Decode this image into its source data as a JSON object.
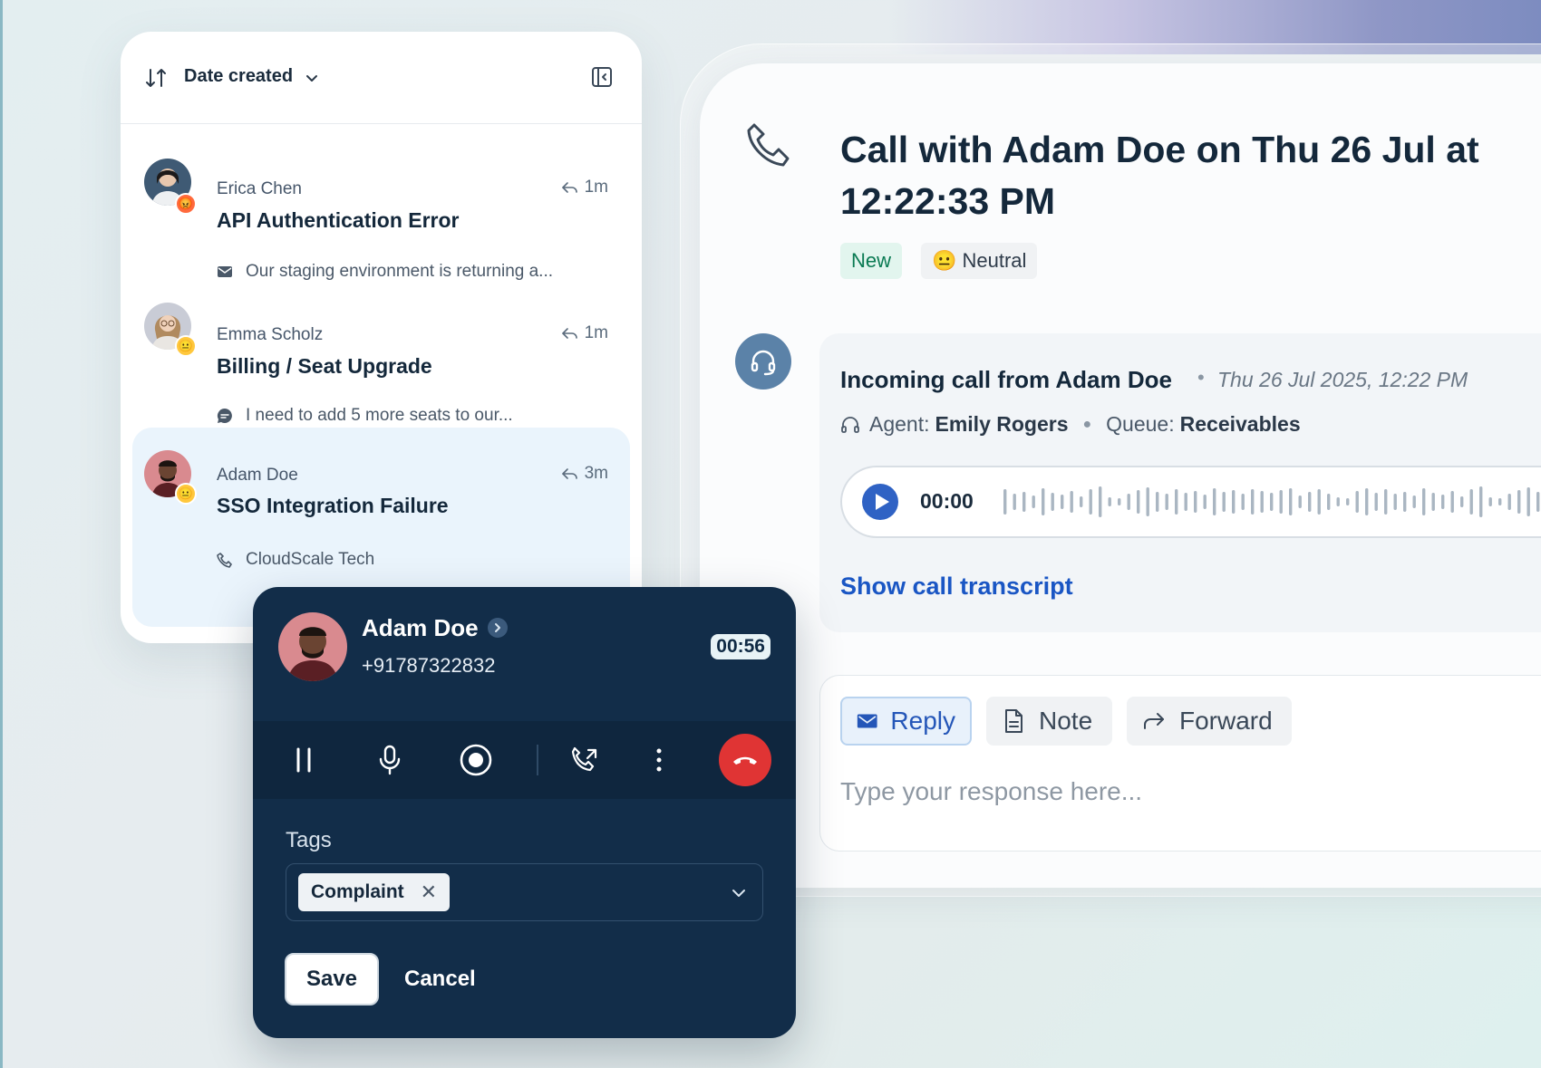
{
  "list": {
    "sort_label": "Date created",
    "conversations": [
      {
        "name": "Erica Chen",
        "title": "API Authentication Error",
        "time": "1m",
        "snippet": "Our staging environment is returning a...",
        "channel": "email-icon",
        "sentiment": "angry"
      },
      {
        "name": "Emma Scholz",
        "title": "Billing / Seat Upgrade",
        "time": "1m",
        "snippet": "I need to add 5 more seats to our...",
        "channel": "chat-icon",
        "sentiment": "neutral"
      },
      {
        "name": "Adam Doe",
        "title": "SSO Integration Failure",
        "time": "3m",
        "snippet": "CloudScale Tech",
        "channel": "phone-icon",
        "sentiment": "neutral"
      }
    ]
  },
  "detail": {
    "title": "Call with Adam Doe on Thu 26 Jul at 12:22:33 PM",
    "status_badge": "New",
    "sentiment_badge": "😐 Neutral",
    "call": {
      "heading": "Incoming call from Adam Doe",
      "date": "Thu 26 Jul 2025, 12:22 PM",
      "agent_label": "Agent:",
      "agent_name": "Emily Rogers",
      "queue_label": "Queue:",
      "queue_name": "Receivables",
      "audio_time": "00:00",
      "transcript_link": "Show call transcript"
    },
    "reply": {
      "tabs": [
        "Reply",
        "Note",
        "Forward"
      ],
      "active_tab": "Reply",
      "placeholder": "Type your response here..."
    }
  },
  "call_widget": {
    "caller_name": "Adam Doe",
    "caller_number": "+91787322832",
    "timer": "00:56",
    "tags_label": "Tags",
    "tags": [
      "Complaint"
    ],
    "save_label": "Save",
    "cancel_label": "Cancel"
  },
  "colors": {
    "accent": "#1a56c4",
    "widget_bg": "#122d49",
    "hangup": "#e03434",
    "selected_row": "#eaf4fc",
    "new_badge": "#0a7a53"
  }
}
